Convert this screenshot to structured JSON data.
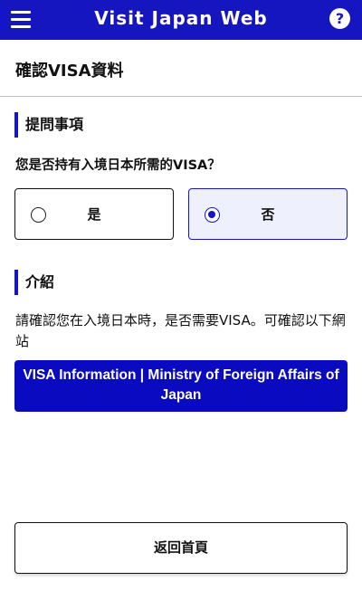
{
  "header": {
    "title": "Visit Japan Web",
    "menu_icon": "hamburger-menu-icon",
    "help_icon": "help-icon",
    "help_glyph": "?",
    "background_color": "#1616c0"
  },
  "page": {
    "title": "確認VISA資料"
  },
  "question_section": {
    "heading": "提問事項",
    "question": "您是否持有入境日本所需的VISA？",
    "options": [
      {
        "label": "是",
        "selected": false
      },
      {
        "label": "否",
        "selected": true
      }
    ]
  },
  "intro_section": {
    "heading": "介紹",
    "text": "請確認您在入境日本時，是否需要VISA。可確認以下網站",
    "link_button": "VISA Information | Ministry of Foreign Affairs of Japan"
  },
  "footer": {
    "back_button": "返回首頁"
  }
}
